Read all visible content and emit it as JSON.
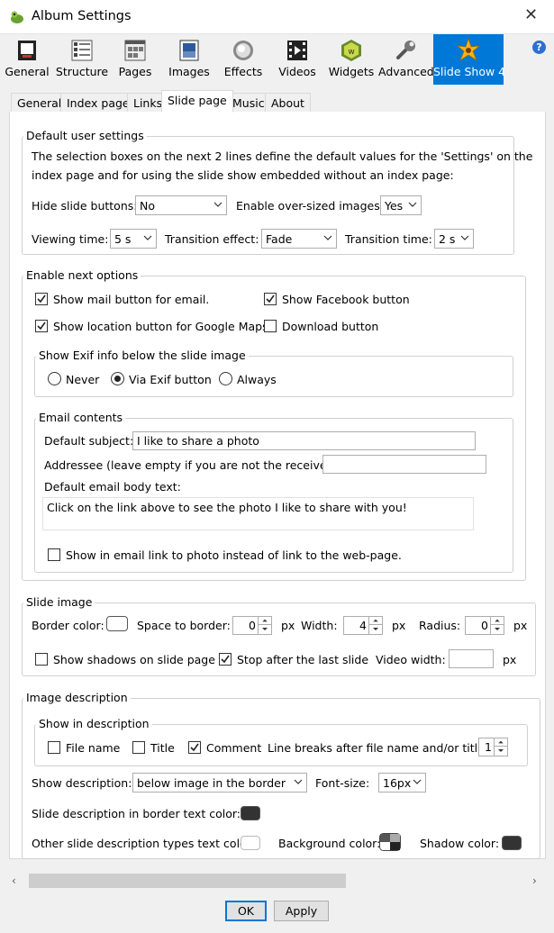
{
  "window": {
    "title": "Album Settings"
  },
  "toolbar": {
    "items": [
      {
        "label": "General"
      },
      {
        "label": "Structure"
      },
      {
        "label": "Pages"
      },
      {
        "label": "Images"
      },
      {
        "label": "Effects"
      },
      {
        "label": "Videos"
      },
      {
        "label": "Widgets"
      },
      {
        "label": "Advanced"
      },
      {
        "label": "Slide Show 4"
      }
    ],
    "help": "?"
  },
  "subtabs": [
    "General",
    "Index page",
    "Links",
    "Slide page",
    "Music",
    "About"
  ],
  "default_user_settings": {
    "legend": "Default user settings",
    "description_line1": "The selection boxes on the next 2 lines define the default values for the 'Settings' on the",
    "description_line2": "index page and for using the slide show embedded without an index page:",
    "hide_slide_buttons_label": "Hide slide buttons:",
    "hide_slide_buttons_value": "No",
    "enable_oversized_label": "Enable over-sized images:",
    "enable_oversized_value": "Yes",
    "viewing_time_label": "Viewing time:",
    "viewing_time_value": "5 s",
    "transition_effect_label": "Transition effect:",
    "transition_effect_value": "Fade",
    "transition_time_label": "Transition time:",
    "transition_time_value": "2 s"
  },
  "enable_next": {
    "legend": "Enable next options",
    "mail_button": {
      "label": "Show mail button for email.",
      "checked": true
    },
    "facebook_button": {
      "label": "Show Facebook button",
      "checked": true
    },
    "location_button": {
      "label": "Show location button for Google Maps",
      "checked": true
    },
    "download_button": {
      "label": "Download button",
      "checked": false
    },
    "exif": {
      "legend": "Show Exif info below the slide image",
      "never": "Never",
      "via_button": "Via Exif button",
      "always": "Always",
      "selected": "via_button"
    },
    "email": {
      "legend": "Email contents",
      "subject_label": "Default subject:",
      "subject_value": "I like to share a photo",
      "addressee_label": "Addressee (leave empty if you are not the receiver):",
      "addressee_value": "",
      "body_label": "Default email body text:",
      "body_value": "Click on the link above to see the photo I like to share with you!",
      "link_to_photo": {
        "label": "Show in email link to photo instead of link to the web-page.",
        "checked": false
      }
    }
  },
  "slide_image": {
    "legend": "Slide image",
    "border_color_label": "Border color:",
    "border_color": "#ffffff",
    "space_label": "Space to border:",
    "space_value": "0",
    "px": "px",
    "width_label": "Width:",
    "width_value": "4",
    "radius_label": "Radius:",
    "radius_value": "0",
    "shadows": {
      "label": "Show shadows on slide page",
      "checked": false
    },
    "stop_after_last": {
      "label": "Stop after the last slide",
      "checked": true
    },
    "video_width_label": "Video width:",
    "video_width_value": ""
  },
  "image_description": {
    "legend": "Image description",
    "show_in": {
      "legend": "Show in description",
      "file_name": {
        "label": "File name",
        "checked": false
      },
      "title": {
        "label": "Title",
        "checked": false
      },
      "comment": {
        "label": "Comment",
        "checked": true
      },
      "line_breaks_label": "Line breaks after file name and/or title:",
      "line_breaks_value": "1"
    },
    "show_description_label": "Show description:",
    "show_description_value": "below image in the border",
    "font_size_label": "Font-size:",
    "font_size_value": "16px",
    "border_text_color_label": "Slide description in border text color:",
    "border_text_color": "#333333",
    "other_text_color_label": "Other slide description types text color:",
    "other_text_color": "#ffffff",
    "background_color_label": "Background color:",
    "shadow_color_label": "Shadow color:",
    "shadow_color": "#333333"
  },
  "buttons": {
    "ok": "OK",
    "apply": "Apply"
  }
}
